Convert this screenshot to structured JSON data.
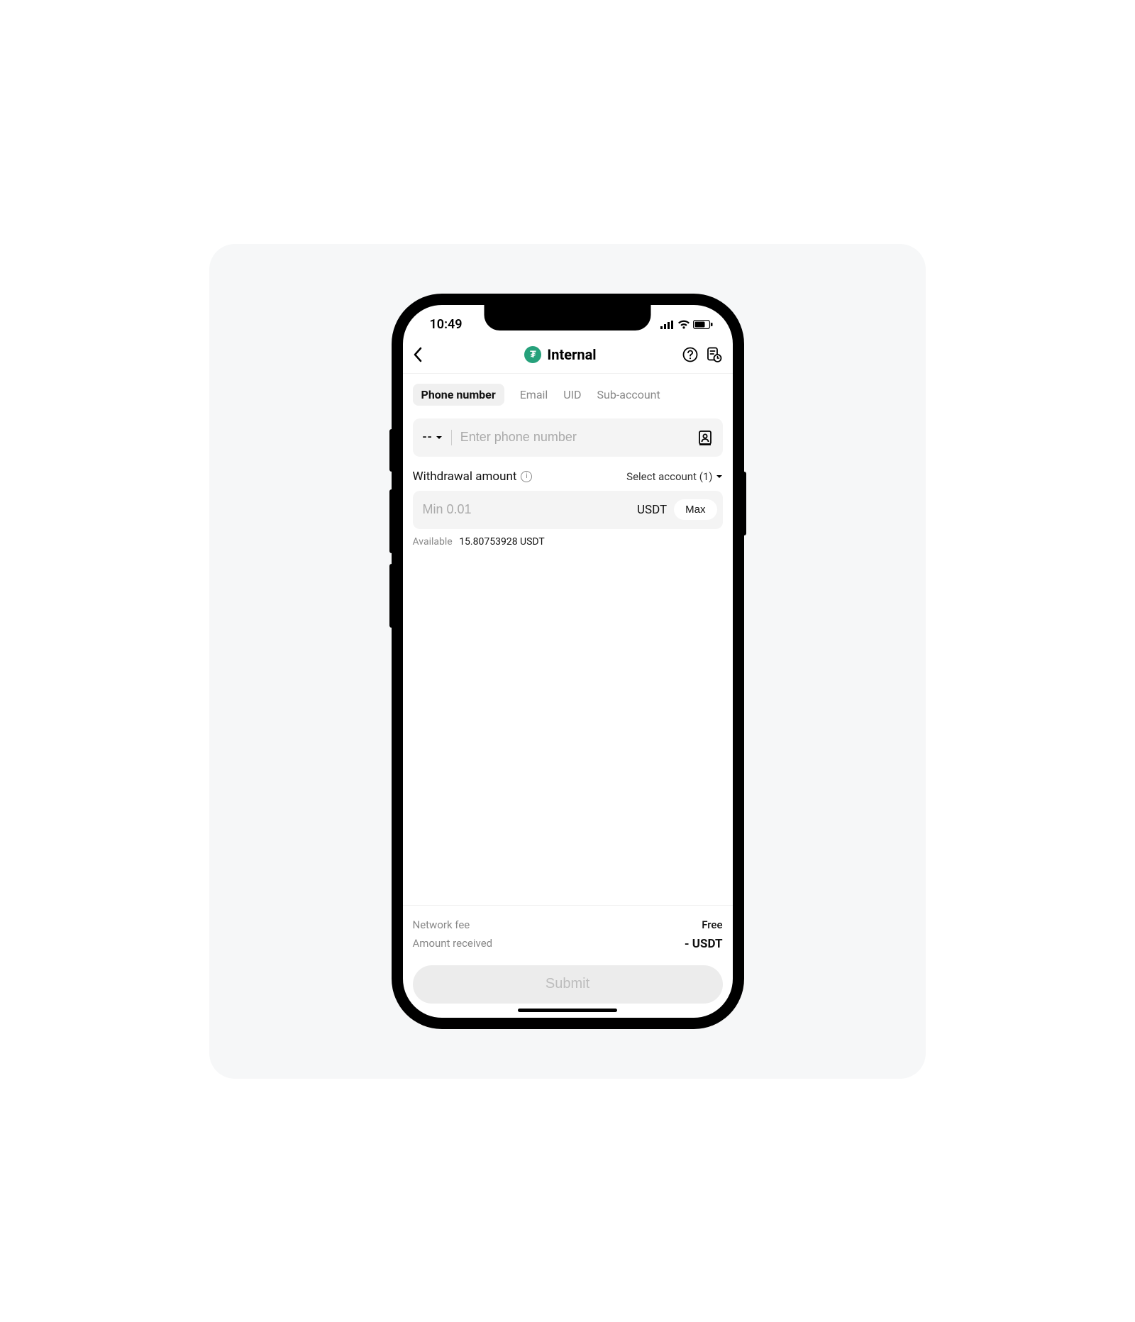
{
  "status": {
    "time": "10:49"
  },
  "nav": {
    "title": "Internal",
    "coin_symbol": "₮"
  },
  "tabs": [
    {
      "label": "Phone number",
      "active": true
    },
    {
      "label": "Email",
      "active": false
    },
    {
      "label": "UID",
      "active": false
    },
    {
      "label": "Sub-account",
      "active": false
    }
  ],
  "phone": {
    "prefix": "--",
    "placeholder": "Enter phone number"
  },
  "amount": {
    "section_label": "Withdrawal amount",
    "select_account_label": "Select account (1)",
    "placeholder": "Min 0.01",
    "currency": "USDT",
    "max_label": "Max",
    "available_label": "Available",
    "available_value": "15.80753928 USDT"
  },
  "footer": {
    "network_fee_label": "Network fee",
    "network_fee_value": "Free",
    "amount_received_label": "Amount received",
    "amount_received_value": "- USDT",
    "submit_label": "Submit"
  }
}
